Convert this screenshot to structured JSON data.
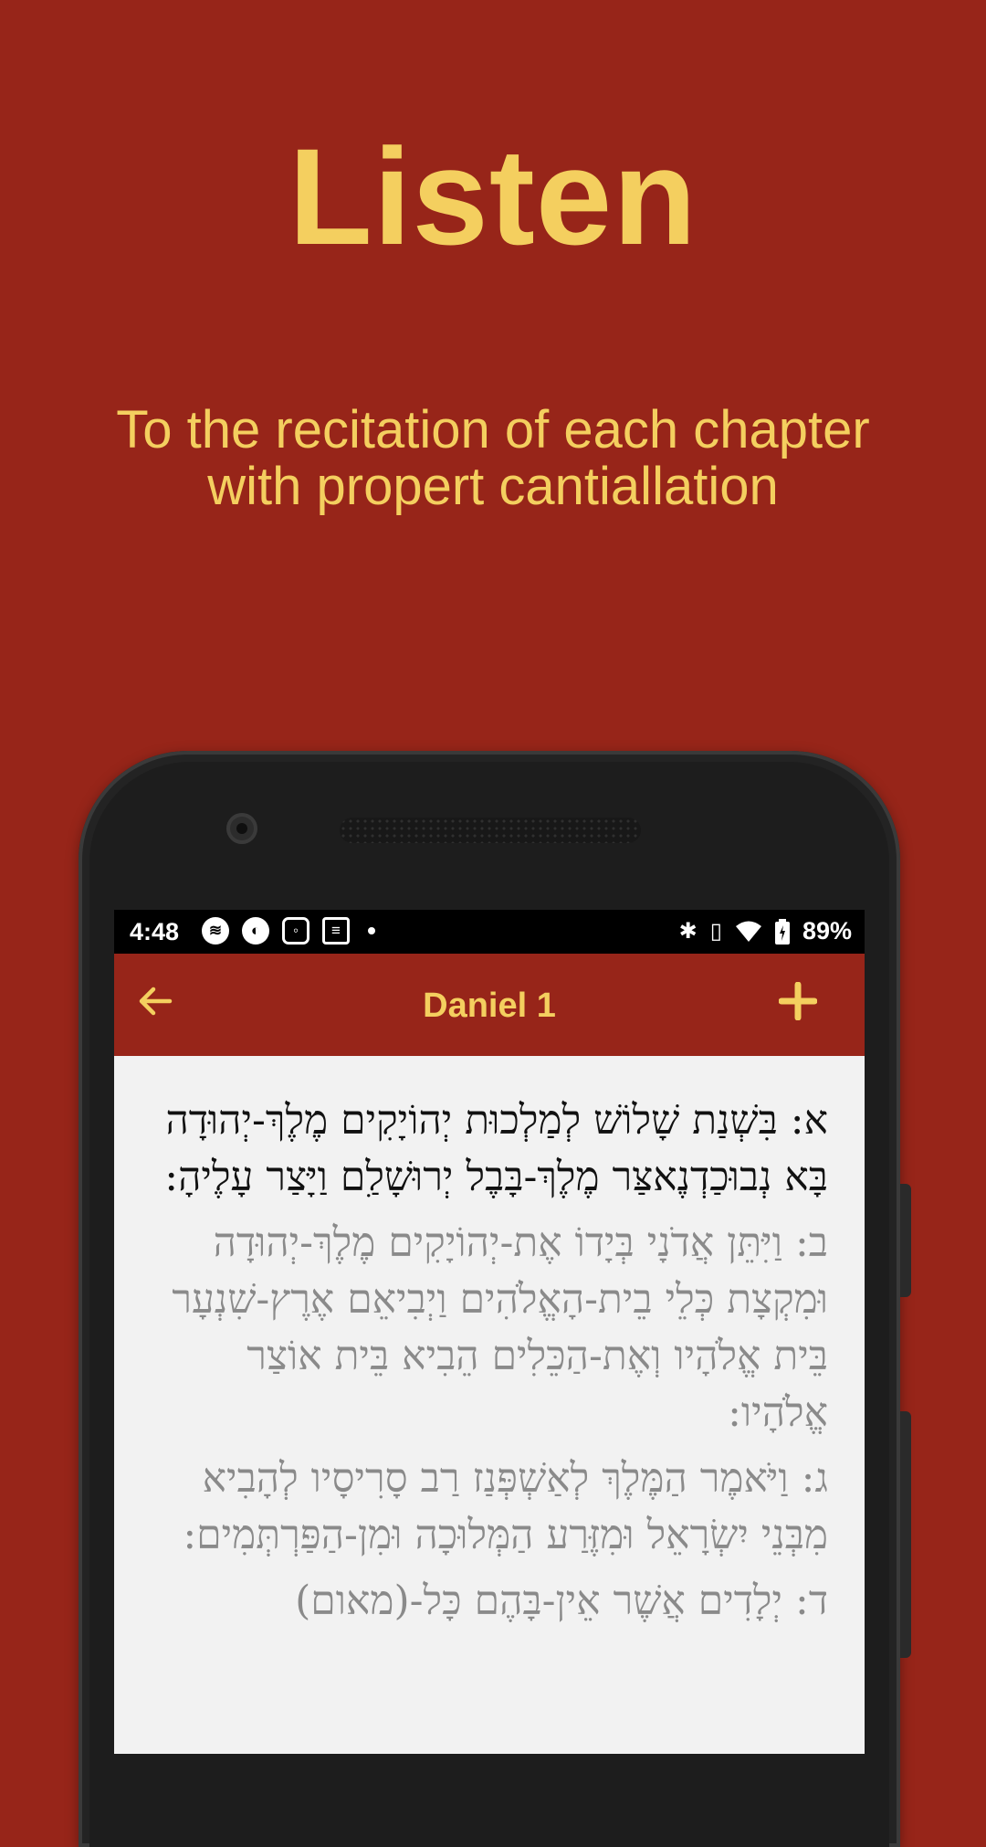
{
  "promo": {
    "headline": "Listen",
    "subtitle_line1": "To the recitation of each chapter",
    "subtitle_line2": "with propert cantiallation"
  },
  "status_bar": {
    "time": "4:48",
    "left_icons": [
      "spotify-icon",
      "app-icon",
      "instagram-icon",
      "news-icon",
      "notification-dot"
    ],
    "right_icons": [
      "bluetooth-icon",
      "vibrate-icon",
      "wifi-icon",
      "battery-icon"
    ],
    "battery": "89%"
  },
  "app_bar": {
    "title": "Daniel 1",
    "back_icon": "arrow-left-icon",
    "add_icon": "plus-icon"
  },
  "verses": [
    {
      "text": "א: בִּשְׁנַת שָׁלוֹשׁ לְמַלְכוּת יְהוֹיָקִים מֶלֶךְ-יְהוּדָה בָּא נְבוּכַדְנֶאצַּר מֶלֶךְ-בָּבֶל יְרוּשָׁלִַם וַיָּצַר עָלֶיהָ:",
      "active": true
    },
    {
      "text": "ב: וַיִּתֵּן אֲדֹנָי בְּיָדוֹ אֶת-יְהוֹיָקִים מֶלֶךְ-יְהוּדָה וּמִקְצָת כְּלֵי בֵית-הָאֱלֹהִים וַיְבִיאֵם אֶרֶץ-שִׁנְעָר בֵּית אֱלֹהָיו וְאֶת-הַכֵּלִים הֵבִיא בֵּית אוֹצַר אֱלֹהָיו:",
      "active": false
    },
    {
      "text": "ג: וַיֹּאמֶר הַמֶּלֶךְ לְאַשְׁפְּנַז רַב סָרִיסָיו לְהָבִיא מִבְּנֵי יִשְׂרָאֵל וּמִזֶּרַע הַמְּלוּכָה וּמִן-הַפַּרְתְּמִים:",
      "active": false
    },
    {
      "text": "ד: יְלָדִים אֲשֶׁר אֵין-בָּהֶם כָּל-(מאום)",
      "active": false
    }
  ]
}
